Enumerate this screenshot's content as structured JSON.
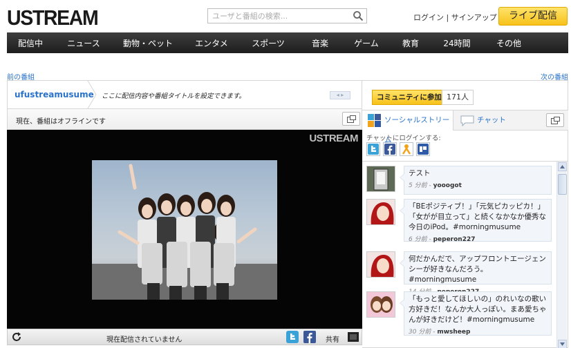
{
  "header": {
    "logo": "USTREAM",
    "search_placeholder": "ユーザと番組の検索...",
    "login": "ログイン",
    "signup": "サインアップ",
    "live_button": "ライブ配信"
  },
  "nav": {
    "items": [
      "配信中",
      "ニュース",
      "動物・ペット",
      "エンタメ",
      "スポーツ",
      "音楽",
      "ゲーム",
      "教育",
      "24時間",
      "その他"
    ]
  },
  "program_nav": {
    "prev": "前の番組",
    "next": "次の番組"
  },
  "channel": {
    "name": "ufustreamusume",
    "description": "ここに配信内容や番組タイトルを設定できます。",
    "status": "現在、番組はオフラインです",
    "watermark": "USTREAM"
  },
  "controls": {
    "status": "現在配信されていません",
    "share_label": "共有"
  },
  "community": {
    "join_button": "コミュニティに参加",
    "count": "171人"
  },
  "tabs": {
    "social": "ソーシャルストリーム",
    "chat": "チャット"
  },
  "chat_login_label": "チャットにログインする:",
  "posts": [
    {
      "text": "テスト",
      "ago": "5 分前",
      "user": "yooogot"
    },
    {
      "text": "「BEポジティブ！」「元気ピカッピカ！」「女がが目立って」と続くなかなか優秀な今日のiPod。#morningmusume",
      "ago": "6 分前",
      "user": "peperon227"
    },
    {
      "text": "何だかんだで、アップフロントエージェンシーが好きなんだろう。#morningmusume",
      "ago": "14 分前",
      "user": "peperon227"
    },
    {
      "text": "「もっと愛してほしいの」のれいなの歌い方好きだ！なんか大人っぽい。まあ愛ちゃんが好きだけど！#morningmusume",
      "ago": "30 分前",
      "user": "mwsheep"
    }
  ],
  "colors": {
    "accent_yellow": "#f7c21a",
    "link_blue": "#2a72c9",
    "nav_dark": "#2a2a2a"
  }
}
